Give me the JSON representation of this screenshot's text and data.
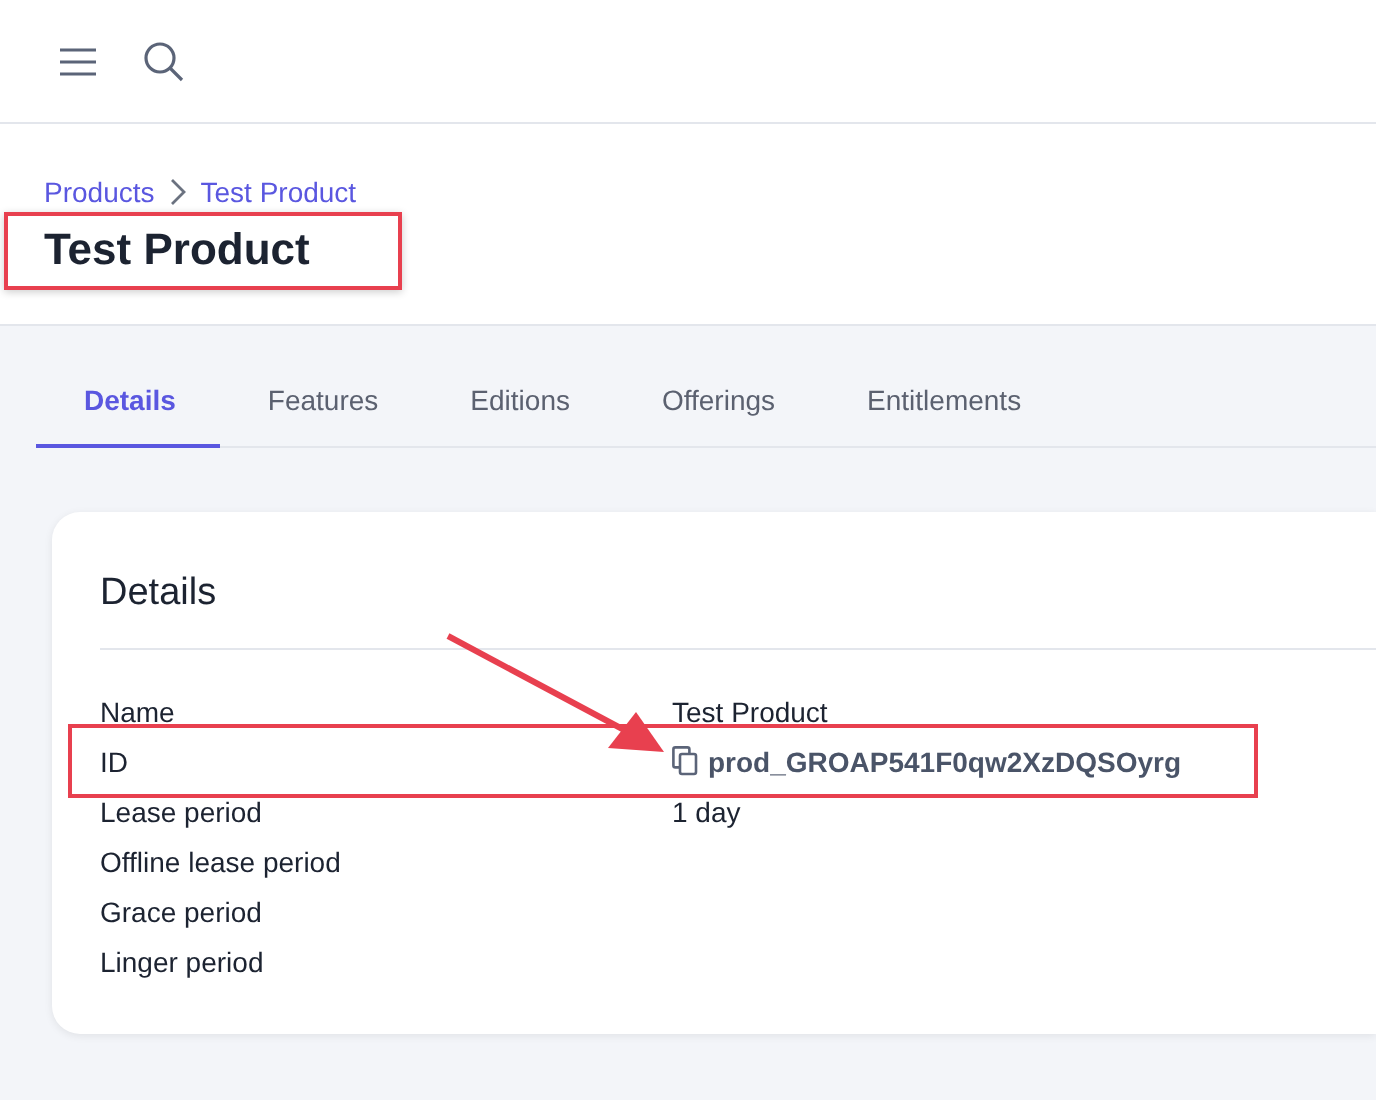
{
  "breadcrumbs": [
    "Products",
    "Test Product"
  ],
  "title": "Test Product",
  "title_highlighted": true,
  "tabs": [
    {
      "label": "Details",
      "selected": true
    },
    {
      "label": "Features",
      "selected": false
    },
    {
      "label": "Editions",
      "selected": false
    },
    {
      "label": "Offerings",
      "selected": false
    },
    {
      "label": "Entitlements",
      "selected": false
    }
  ],
  "card": {
    "heading": "Details",
    "rows": [
      {
        "label": "Name",
        "value": "Test Product",
        "copyable": false,
        "highlighted": false
      },
      {
        "label": "ID",
        "value": "prod_GROAP541F0qw2XzDQSOyrg",
        "copyable": true,
        "highlighted": true
      },
      {
        "label": "Lease period",
        "value": "1 day",
        "copyable": false,
        "highlighted": false
      },
      {
        "label": "Offline lease period",
        "highlighted": false
      },
      {
        "label": "Grace period",
        "highlighted": false
      },
      {
        "label": "Linger period",
        "highlighted": false
      }
    ]
  },
  "arrow": true
}
